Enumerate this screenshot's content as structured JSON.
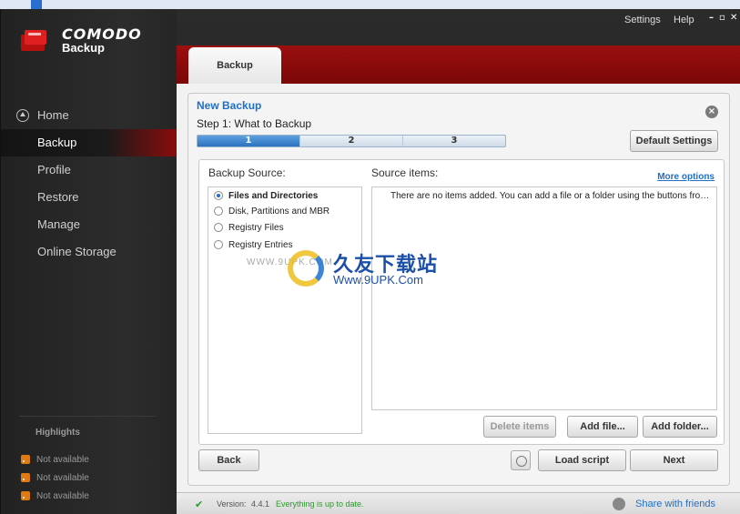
{
  "window": {
    "brand_name": "COMODO",
    "brand_product": "Backup",
    "settings_link": "Settings",
    "help_link": "Help"
  },
  "sidebar": {
    "items": [
      {
        "label": "Home"
      },
      {
        "label": "Backup"
      },
      {
        "label": "Profile"
      },
      {
        "label": "Restore"
      },
      {
        "label": "Manage"
      },
      {
        "label": "Online Storage"
      }
    ],
    "highlights_title": "Highlights",
    "highlights": [
      "Not available",
      "Not available",
      "Not available"
    ]
  },
  "header": {
    "active_tab": "Backup"
  },
  "wizard": {
    "title": "New Backup",
    "step_title": "Step 1: What to Backup",
    "steps": [
      "1",
      "2",
      "3"
    ],
    "default_settings_label": "Default Settings",
    "source_label": "Backup Source:",
    "items_label": "Source items:",
    "more_options_label": "More options",
    "sources": [
      {
        "label": "Files and Directories",
        "checked": true
      },
      {
        "label": "Disk, Partitions and MBR",
        "checked": false
      },
      {
        "label": "Registry Files",
        "checked": false
      },
      {
        "label": "Registry Entries",
        "checked": false
      }
    ],
    "empty_message": "There are no items added. You can add a file or a folder using the buttons from ...",
    "delete_items_label": "Delete items",
    "add_file_label": "Add file...",
    "add_folder_label": "Add folder...",
    "back_label": "Back",
    "load_script_label": "Load script",
    "next_label": "Next"
  },
  "status": {
    "version_label": "Version:",
    "version": "4.4.1",
    "message": "Everything is up to date.",
    "share_label": "Share with friends"
  },
  "watermark": {
    "site_name": "久友下载站",
    "url": "Www.9UPK.Com",
    "small": "WWW.9UPK.COM"
  },
  "colors": {
    "accent_red": "#8a0b0b",
    "link_blue": "#1f6fcc",
    "ok_green": "#2a9a2a"
  }
}
